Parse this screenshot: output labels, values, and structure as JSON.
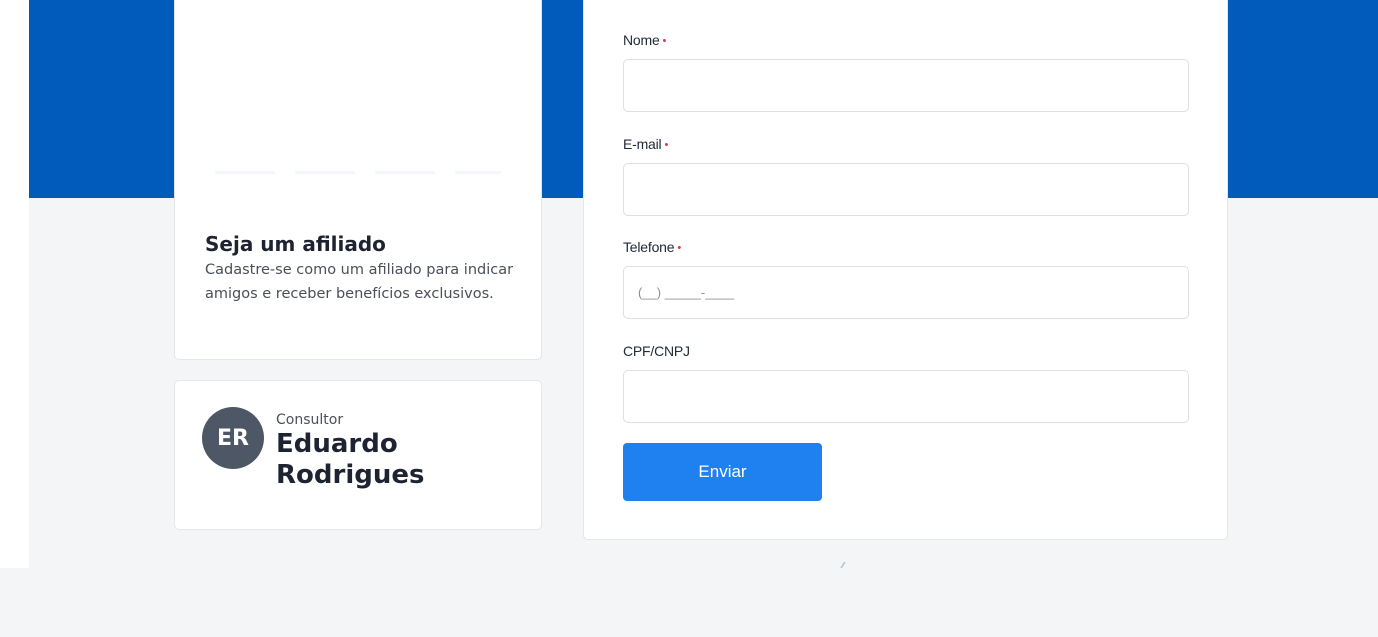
{
  "sidebar": {
    "info_card": {
      "title": "Seja um afiliado",
      "text": "Cadastre-se como um afiliado para indicar amigos e receber benefícios exclusivos."
    },
    "consultant": {
      "initials": "ER",
      "role": "Consultor",
      "name": "Eduardo Rodrigues"
    }
  },
  "form": {
    "fields": [
      {
        "label": "Nome",
        "required": "•",
        "value": "",
        "placeholder": ""
      },
      {
        "label": "E-mail",
        "required": "•",
        "value": "",
        "placeholder": ""
      },
      {
        "label": "Telefone",
        "required": "•",
        "value": "",
        "placeholder": "(__) _____-____"
      },
      {
        "label": "CPF/CNPJ",
        "required": "",
        "value": "",
        "placeholder": ""
      }
    ],
    "submit_label": "Enviar"
  },
  "colors": {
    "hero": "#005bbb",
    "button": "#1f80f0",
    "required": "#e0334a",
    "avatar": "#4d5766"
  }
}
